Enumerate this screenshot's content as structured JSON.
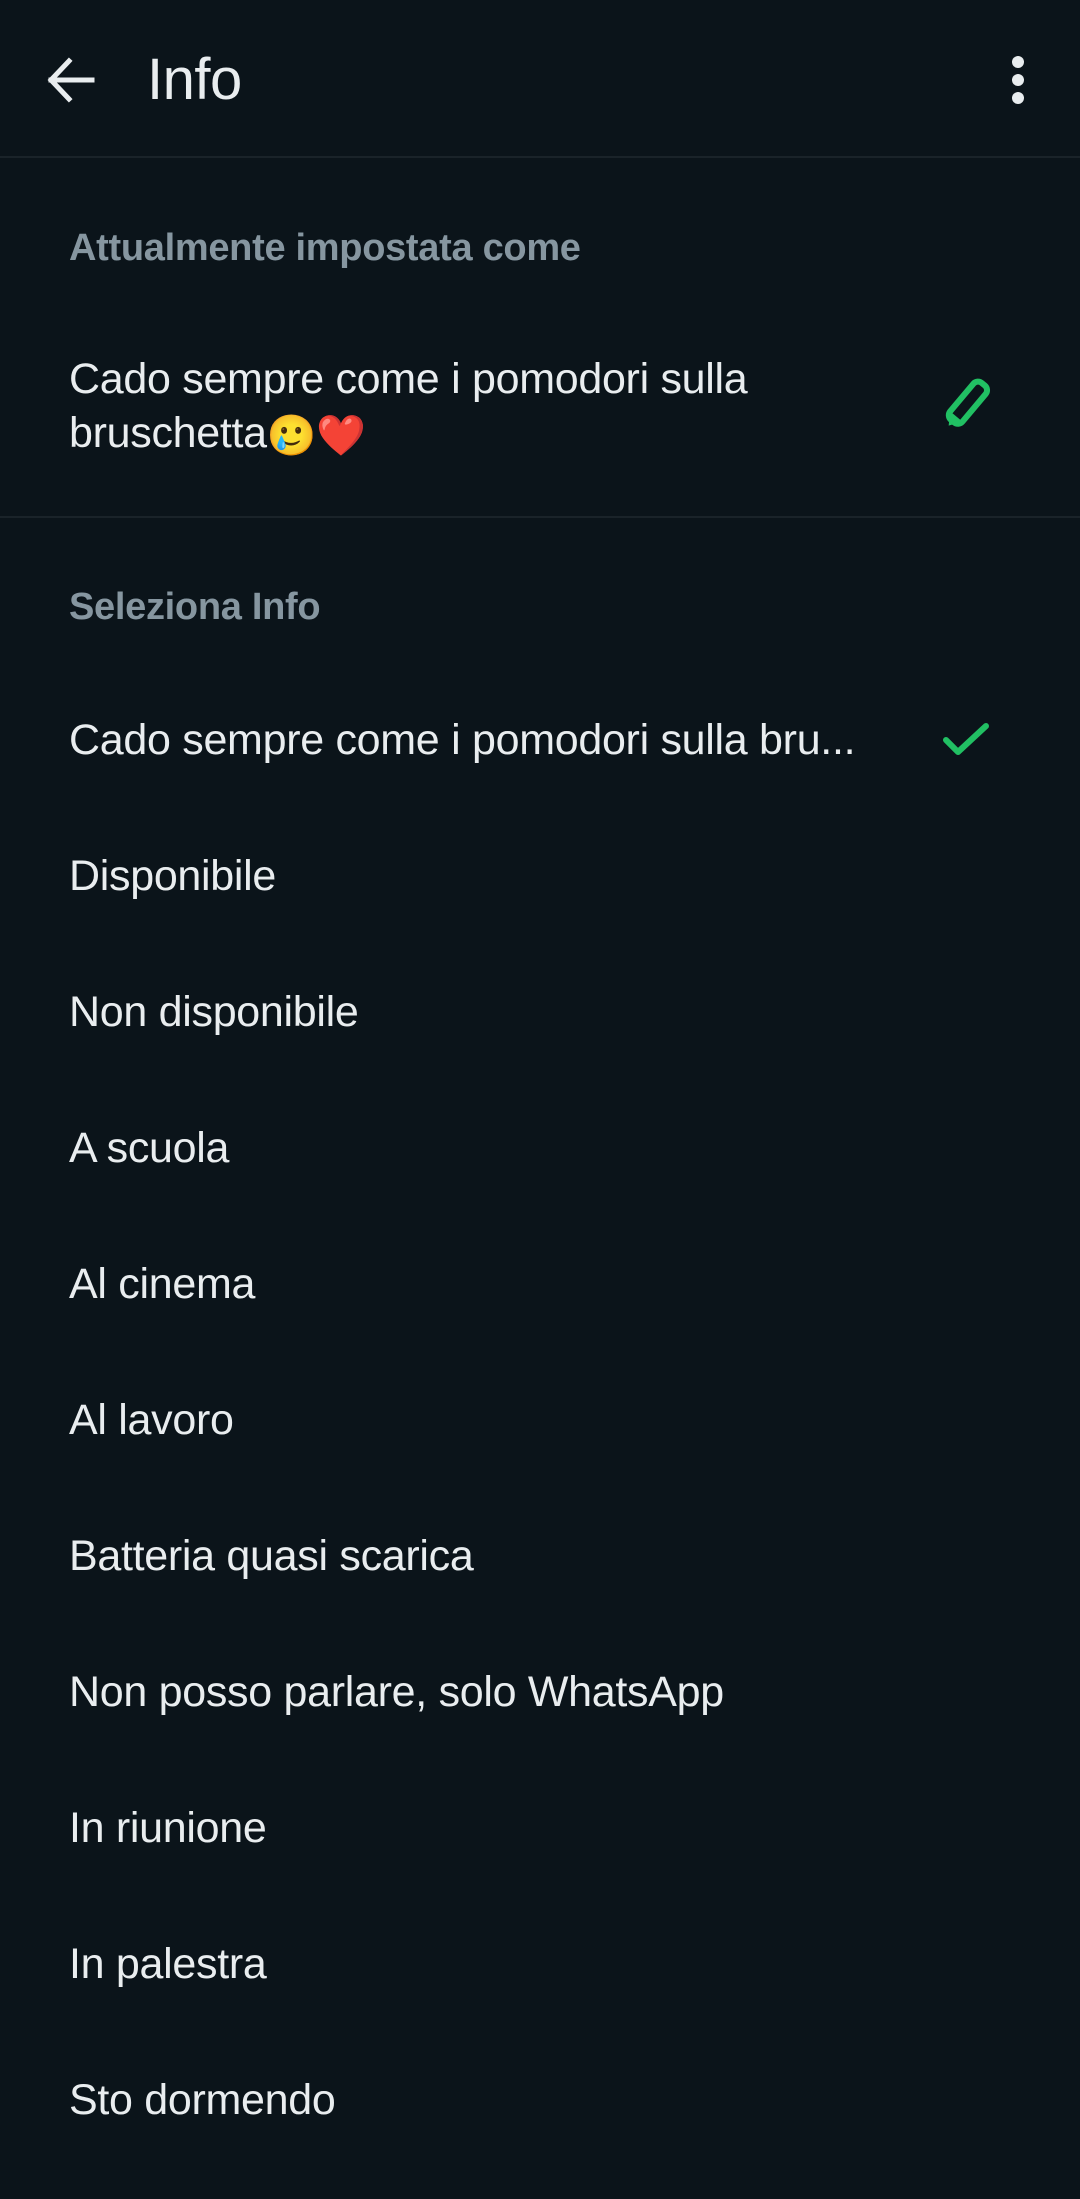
{
  "app_bar": {
    "title": "Info",
    "back_icon": "arrow-left-icon",
    "menu_icon": "more-vertical-icon"
  },
  "current": {
    "label": "Attualmente impostata come",
    "text": "Cado sempre come i pomodori sulla bruschetta",
    "emojis": "🥲❤️",
    "edit_icon": "pencil-icon"
  },
  "select": {
    "label": "Seleziona Info",
    "items": [
      {
        "label": "Cado sempre come i pomodori sulla bru...",
        "selected": true
      },
      {
        "label": "Disponibile",
        "selected": false
      },
      {
        "label": "Non disponibile",
        "selected": false
      },
      {
        "label": "A scuola",
        "selected": false
      },
      {
        "label": "Al cinema",
        "selected": false
      },
      {
        "label": "Al lavoro",
        "selected": false
      },
      {
        "label": "Batteria quasi scarica",
        "selected": false
      },
      {
        "label": "Non posso parlare, solo WhatsApp",
        "selected": false
      },
      {
        "label": "In riunione",
        "selected": false
      },
      {
        "label": "In palestra",
        "selected": false
      },
      {
        "label": "Sto dormendo",
        "selected": false
      }
    ]
  },
  "colors": {
    "background": "#0b141a",
    "accent": "#21c063",
    "secondary_text": "#8696a0",
    "primary_text": "#e9edef"
  }
}
